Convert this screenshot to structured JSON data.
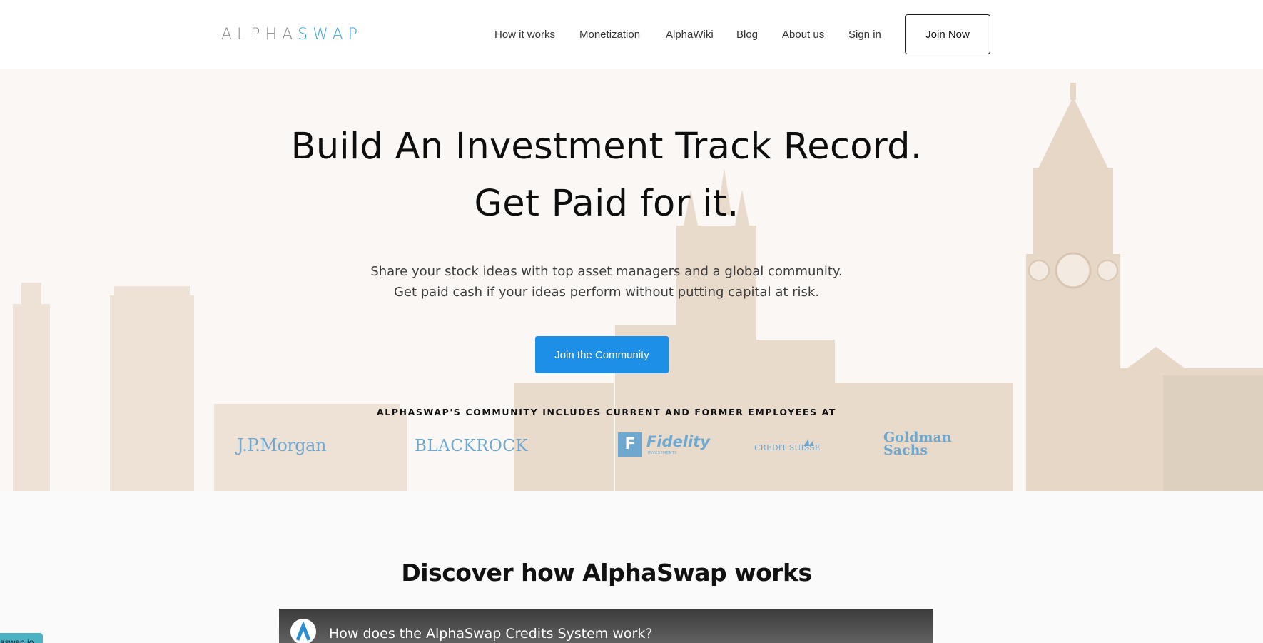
{
  "header": {
    "logo_part1": "ALPHA",
    "logo_part2": "SWAP",
    "nav": [
      {
        "label": "How it works"
      },
      {
        "label": "Monetization"
      },
      {
        "label": "AlphaWiki"
      },
      {
        "label": "Blog"
      },
      {
        "label": "About us"
      },
      {
        "label": "Sign in"
      }
    ],
    "join_now_label": "Join Now"
  },
  "hero": {
    "headline_line1": "Build An Investment Track Record.",
    "headline_line2": "Get Paid for it.",
    "subtitle_line1": "Share your stock ideas with top asset managers and a global community.",
    "subtitle_line2": "Get paid cash if your ideas perform without putting capital at risk.",
    "cta_label": "Join the Community",
    "community_label": "ALPHASWAP'S COMMUNITY INCLUDES CURRENT AND FORMER EMPLOYEES AT",
    "brands": {
      "jpmorgan": "J.P.Morgan",
      "blackrock": "BLACKROCK",
      "fidelity": "Fidelity",
      "fidelity_sub": "INVESTMENTS",
      "creditsuisse": "CREDIT SUISSE",
      "goldman_line1": "Goldman",
      "goldman_line2": "Sachs"
    }
  },
  "discover": {
    "title": "Discover how AlphaSwap works",
    "video_title": "How does the AlphaSwap Credits System work?"
  },
  "badge_text": "aswap.io",
  "colors": {
    "accent": "#1e8fe6",
    "logo_blue": "#3aa6dc",
    "hero_bg": "#fbf7f4",
    "brand_logo": "#6ea8cf"
  }
}
